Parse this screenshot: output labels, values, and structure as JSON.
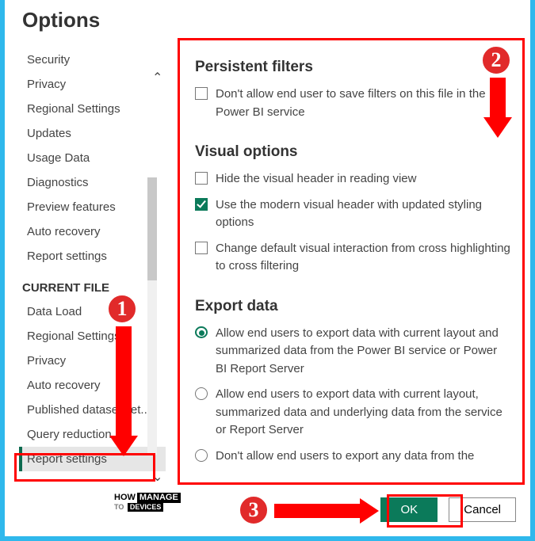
{
  "title": "Options",
  "sidebar": {
    "global_items": [
      "Security",
      "Privacy",
      "Regional Settings",
      "Updates",
      "Usage Data",
      "Diagnostics",
      "Preview features",
      "Auto recovery",
      "Report settings"
    ],
    "section_label": "CURRENT FILE",
    "file_items": [
      "Data Load",
      "Regional Settings",
      "Privacy",
      "Auto recovery",
      "Published dataset set...",
      "Query reduction",
      "Report settings"
    ]
  },
  "main": {
    "groups": [
      {
        "title": "Persistent filters",
        "options": [
          {
            "type": "checkbox",
            "checked": false,
            "label": "Don't allow end user to save filters on this file in the Power BI service"
          }
        ]
      },
      {
        "title": "Visual options",
        "options": [
          {
            "type": "checkbox",
            "checked": false,
            "label": "Hide the visual header in reading view"
          },
          {
            "type": "checkbox",
            "checked": true,
            "label": "Use the modern visual header with updated styling options"
          },
          {
            "type": "checkbox",
            "checked": false,
            "label": "Change default visual interaction from cross highlighting to cross filtering"
          }
        ]
      },
      {
        "title": "Export data",
        "options": [
          {
            "type": "radio",
            "checked": true,
            "label": "Allow end users to export data with current layout and summarized data from the Power BI service or Power BI Report Server"
          },
          {
            "type": "radio",
            "checked": false,
            "label": "Allow end users to export data with current layout, summarized data and underlying data from the service or Report Server"
          },
          {
            "type": "radio",
            "checked": false,
            "label": "Don't allow end users to export any data from the service or Report Server"
          }
        ]
      }
    ]
  },
  "buttons": {
    "ok": "OK",
    "cancel": "Cancel"
  },
  "annotations": {
    "step1": "1",
    "step2": "2",
    "step3": "3"
  },
  "watermark": {
    "l1a": "HOW",
    "l1b": "MANAGE",
    "l2a": "TO",
    "l2b": "DEVICES"
  }
}
